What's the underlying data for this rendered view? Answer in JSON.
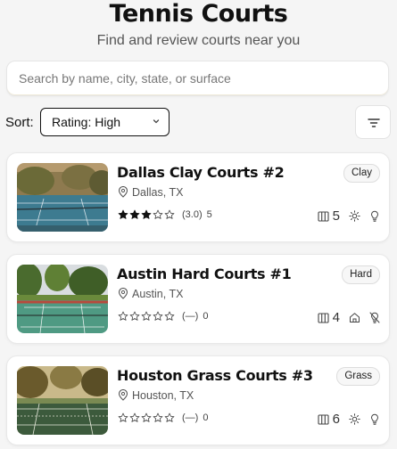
{
  "header": {
    "title": "Tennis Courts",
    "subtitle": "Find and review courts near you"
  },
  "search": {
    "placeholder": "Search by name, city, state, or surface",
    "value": ""
  },
  "sort": {
    "label": "Sort:",
    "selected": "Rating: High"
  },
  "courts": [
    {
      "name": "Dallas Clay Courts #2",
      "location": "Dallas, TX",
      "surface": "Clay",
      "stars_filled": 3,
      "rating_text": "(3.0)",
      "review_count": "5",
      "court_count": "5",
      "icons": [
        "court-count-icon",
        "sun-icon",
        "lightbulb-icon"
      ]
    },
    {
      "name": "Austin Hard Courts #1",
      "location": "Austin, TX",
      "surface": "Hard",
      "stars_filled": 0,
      "rating_text": "(—)",
      "review_count": "0",
      "court_count": "4",
      "icons": [
        "court-count-icon",
        "indoor-home-icon",
        "lightbulb-off-icon"
      ]
    },
    {
      "name": "Houston Grass Courts #3",
      "location": "Houston, TX",
      "surface": "Grass",
      "stars_filled": 0,
      "rating_text": "(—)",
      "review_count": "0",
      "court_count": "6",
      "icons": [
        "court-count-icon",
        "sun-icon",
        "lightbulb-icon"
      ]
    }
  ],
  "colors": {
    "background": "#f5f5f5",
    "card": "#ffffff",
    "text": "#111111",
    "muted": "#555555",
    "court_blue": "#3a6f8c",
    "court_green": "#4f9a83"
  }
}
